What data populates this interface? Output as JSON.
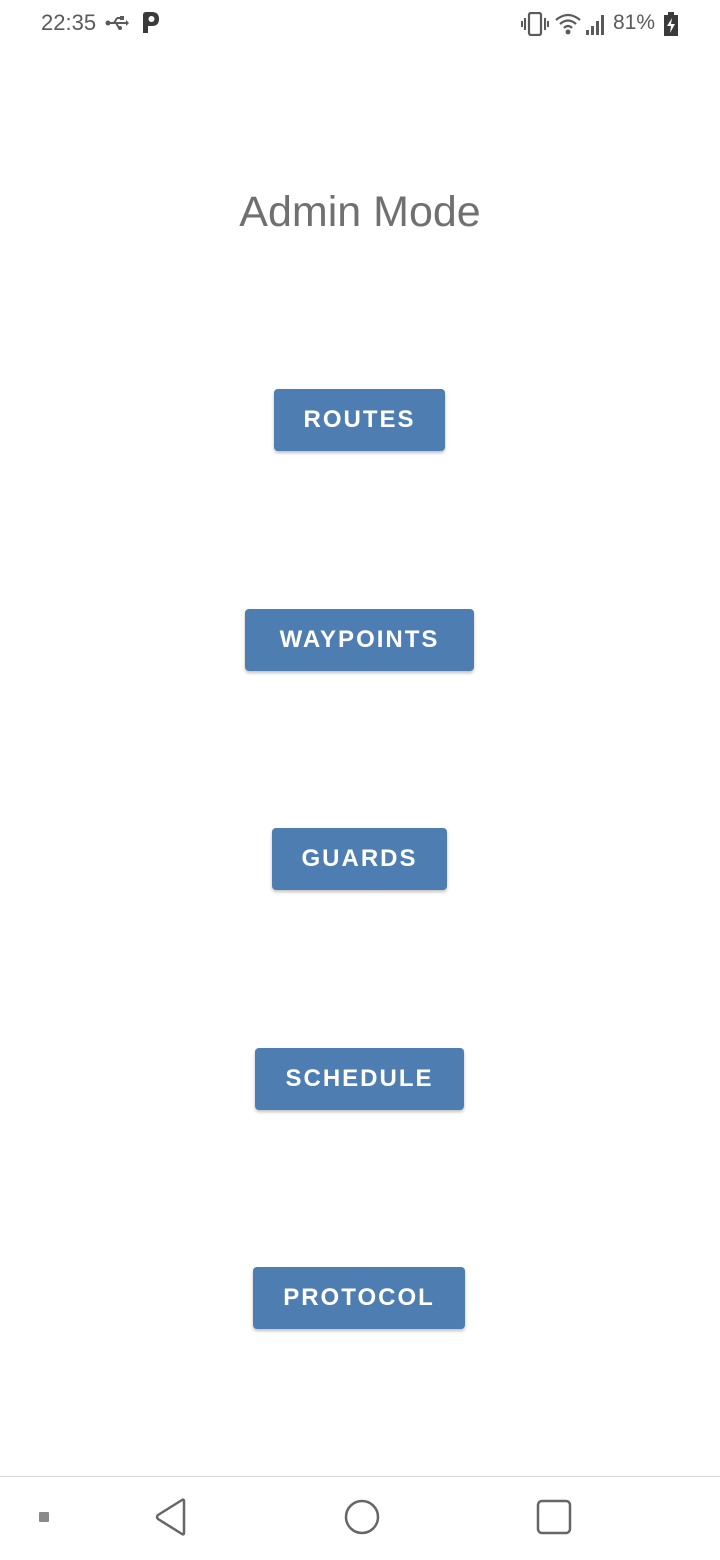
{
  "status_bar": {
    "time": "22:35",
    "battery_percent": "81%",
    "icons": [
      "usb-icon",
      "parking-app-icon",
      "vibrate-icon",
      "wifi-icon",
      "signal-icon",
      "battery-charging-icon"
    ]
  },
  "page": {
    "title": "Admin Mode"
  },
  "menu": {
    "routes_label": "ROUTES",
    "waypoints_label": "WAYPOINTS",
    "guards_label": "GUARDS",
    "schedule_label": "SCHEDULE",
    "protocol_label": "PROTOCOL"
  },
  "nav_bar": {
    "icons": [
      "menu-dot-icon",
      "back-icon",
      "home-icon",
      "recents-icon"
    ]
  },
  "colors": {
    "button_bg": "#4e7db2",
    "button_text": "#ffffff",
    "title_text": "#707070",
    "background": "#ffffff"
  }
}
